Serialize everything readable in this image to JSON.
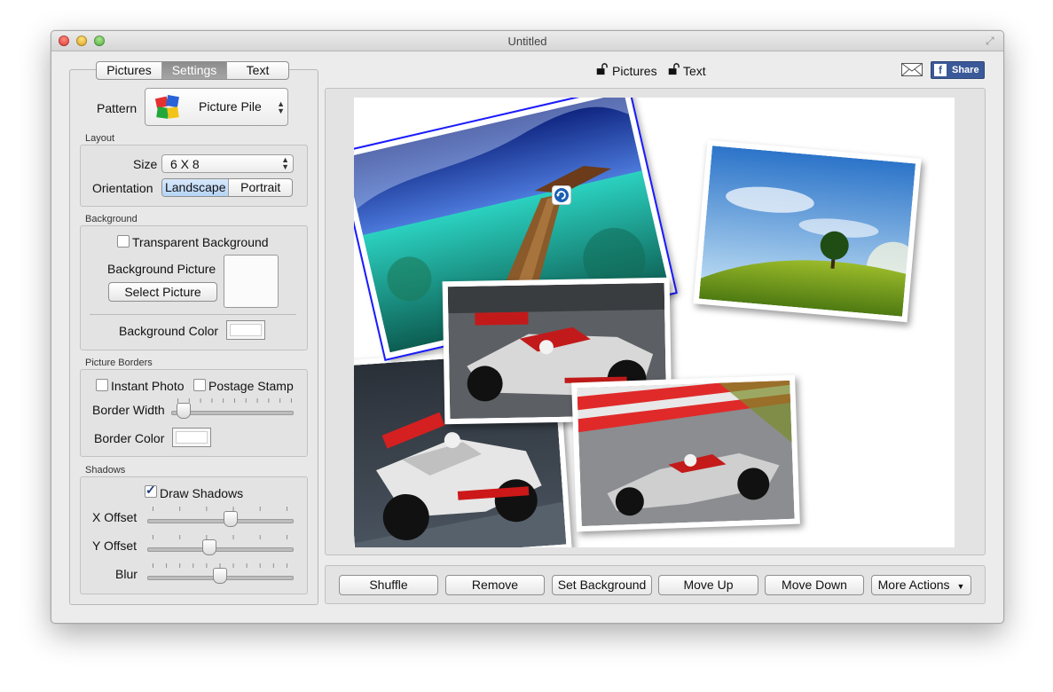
{
  "window": {
    "title": "Untitled"
  },
  "sidebar": {
    "tabs": [
      {
        "label": "Pictures",
        "selected": false
      },
      {
        "label": "Settings",
        "selected": true
      },
      {
        "label": "Text",
        "selected": false
      }
    ],
    "pattern": {
      "label": "Pattern",
      "value": "Picture Pile"
    },
    "layout": {
      "title": "Layout",
      "size_label": "Size",
      "size_value": "6 X 8",
      "orientation_label": "Orientation",
      "orientation_options": [
        "Landscape",
        "Portrait"
      ],
      "orientation_selected": "Landscape"
    },
    "background": {
      "title": "Background",
      "transparent_label": "Transparent Background",
      "transparent_checked": false,
      "picture_label": "Background Picture",
      "select_button": "Select Picture",
      "color_label": "Background Color",
      "color": "#ffffff"
    },
    "borders": {
      "title": "Picture Borders",
      "instant_photo_label": "Instant Photo",
      "instant_photo_checked": false,
      "postage_stamp_label": "Postage Stamp",
      "postage_stamp_checked": false,
      "width_label": "Border Width",
      "width_level": 0.05,
      "color_label": "Border Color",
      "color": "#ffffff"
    },
    "shadows": {
      "title": "Shadows",
      "draw_label": "Draw Shadows",
      "draw_checked": true,
      "x_offset_label": "X Offset",
      "x_offset_level": 0.58,
      "y_offset_label": "Y Offset",
      "y_offset_level": 0.42,
      "blur_label": "Blur",
      "blur_level": 0.5
    }
  },
  "toolbar": {
    "pictures_lock_label": "Pictures",
    "text_lock_label": "Text",
    "share_label": "Share",
    "share_brand": "f"
  },
  "actions": {
    "shuffle": "Shuffle",
    "remove": "Remove",
    "set_background": "Set Background",
    "move_up": "Move Up",
    "move_down": "Move Down",
    "more_actions": "More Actions"
  },
  "colors": {
    "selection_border": "#1a1aff",
    "facebook": "#3b5998",
    "tab_selected": "#8c8c8c"
  },
  "icons": {
    "rotate": "rotate-icon",
    "lock": "open-lock-icon",
    "mail": "mail-icon",
    "pattern": "picture-pile-icon"
  }
}
